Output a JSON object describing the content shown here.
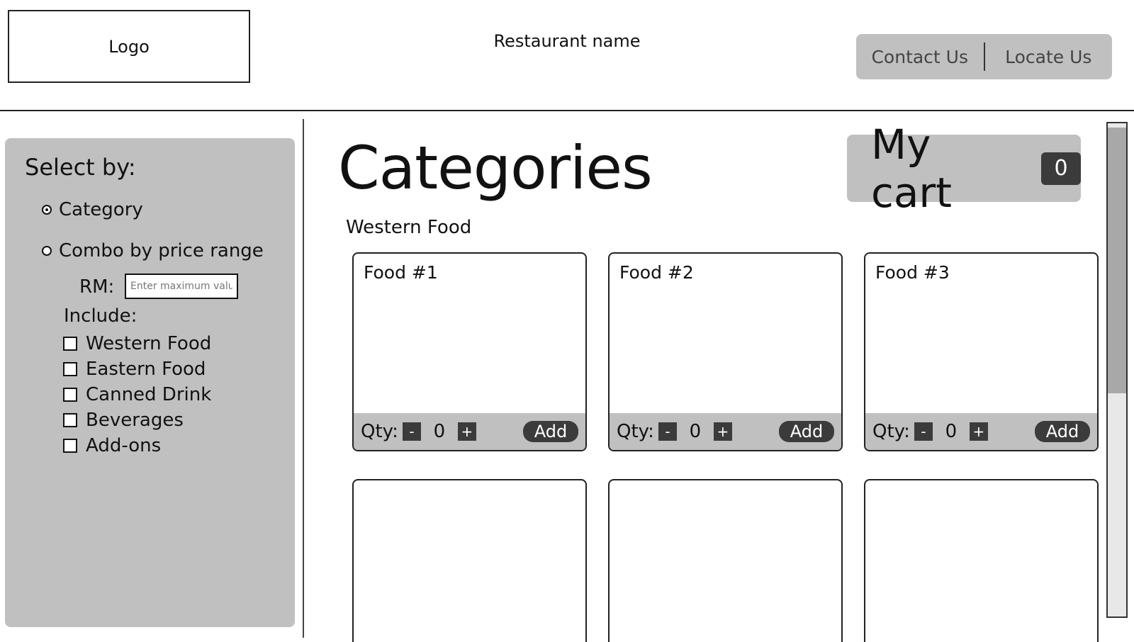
{
  "header": {
    "logo_label": "Logo",
    "restaurant_name": "Restaurant name",
    "nav": [
      "Contact Us",
      "Locate Us"
    ]
  },
  "sidebar": {
    "title": "Select by:",
    "options": [
      {
        "label": "Category",
        "selected": true
      },
      {
        "label": "Combo by price range",
        "selected": false
      }
    ],
    "price": {
      "currency_label": "RM:",
      "placeholder": "Enter maximum value",
      "value": ""
    },
    "include_label": "Include:",
    "include_items": [
      "Western Food",
      "Eastern Food",
      "Canned Drink",
      "Beverages",
      "Add-ons"
    ]
  },
  "main": {
    "title": "Categories",
    "cart": {
      "label": "My cart",
      "count": "0"
    },
    "section_title": "Western Food",
    "cards": [
      {
        "name": "Food #1",
        "qty_label": "Qty:",
        "minus": "-",
        "qty": "0",
        "plus": "+",
        "add_label": "Add"
      },
      {
        "name": "Food #2",
        "qty_label": "Qty:",
        "minus": "-",
        "qty": "0",
        "plus": "+",
        "add_label": "Add"
      },
      {
        "name": "Food #3",
        "qty_label": "Qty:",
        "minus": "-",
        "qty": "0",
        "plus": "+",
        "add_label": "Add"
      }
    ]
  },
  "colors": {
    "panel_gray": "#c0c0c0",
    "dark_button": "#3b3b3b",
    "border": "#222222"
  }
}
